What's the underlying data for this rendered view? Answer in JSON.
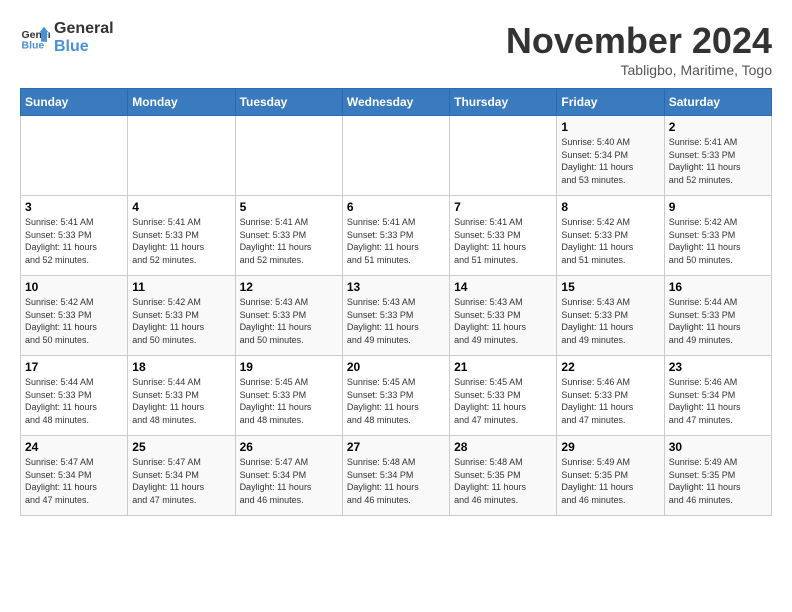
{
  "logo": {
    "line1": "General",
    "line2": "Blue"
  },
  "title": "November 2024",
  "subtitle": "Tabligbo, Maritime, Togo",
  "weekdays": [
    "Sunday",
    "Monday",
    "Tuesday",
    "Wednesday",
    "Thursday",
    "Friday",
    "Saturday"
  ],
  "weeks": [
    [
      {
        "day": "",
        "info": ""
      },
      {
        "day": "",
        "info": ""
      },
      {
        "day": "",
        "info": ""
      },
      {
        "day": "",
        "info": ""
      },
      {
        "day": "",
        "info": ""
      },
      {
        "day": "1",
        "info": "Sunrise: 5:40 AM\nSunset: 5:34 PM\nDaylight: 11 hours\nand 53 minutes."
      },
      {
        "day": "2",
        "info": "Sunrise: 5:41 AM\nSunset: 5:33 PM\nDaylight: 11 hours\nand 52 minutes."
      }
    ],
    [
      {
        "day": "3",
        "info": "Sunrise: 5:41 AM\nSunset: 5:33 PM\nDaylight: 11 hours\nand 52 minutes."
      },
      {
        "day": "4",
        "info": "Sunrise: 5:41 AM\nSunset: 5:33 PM\nDaylight: 11 hours\nand 52 minutes."
      },
      {
        "day": "5",
        "info": "Sunrise: 5:41 AM\nSunset: 5:33 PM\nDaylight: 11 hours\nand 52 minutes."
      },
      {
        "day": "6",
        "info": "Sunrise: 5:41 AM\nSunset: 5:33 PM\nDaylight: 11 hours\nand 51 minutes."
      },
      {
        "day": "7",
        "info": "Sunrise: 5:41 AM\nSunset: 5:33 PM\nDaylight: 11 hours\nand 51 minutes."
      },
      {
        "day": "8",
        "info": "Sunrise: 5:42 AM\nSunset: 5:33 PM\nDaylight: 11 hours\nand 51 minutes."
      },
      {
        "day": "9",
        "info": "Sunrise: 5:42 AM\nSunset: 5:33 PM\nDaylight: 11 hours\nand 50 minutes."
      }
    ],
    [
      {
        "day": "10",
        "info": "Sunrise: 5:42 AM\nSunset: 5:33 PM\nDaylight: 11 hours\nand 50 minutes."
      },
      {
        "day": "11",
        "info": "Sunrise: 5:42 AM\nSunset: 5:33 PM\nDaylight: 11 hours\nand 50 minutes."
      },
      {
        "day": "12",
        "info": "Sunrise: 5:43 AM\nSunset: 5:33 PM\nDaylight: 11 hours\nand 50 minutes."
      },
      {
        "day": "13",
        "info": "Sunrise: 5:43 AM\nSunset: 5:33 PM\nDaylight: 11 hours\nand 49 minutes."
      },
      {
        "day": "14",
        "info": "Sunrise: 5:43 AM\nSunset: 5:33 PM\nDaylight: 11 hours\nand 49 minutes."
      },
      {
        "day": "15",
        "info": "Sunrise: 5:43 AM\nSunset: 5:33 PM\nDaylight: 11 hours\nand 49 minutes."
      },
      {
        "day": "16",
        "info": "Sunrise: 5:44 AM\nSunset: 5:33 PM\nDaylight: 11 hours\nand 49 minutes."
      }
    ],
    [
      {
        "day": "17",
        "info": "Sunrise: 5:44 AM\nSunset: 5:33 PM\nDaylight: 11 hours\nand 48 minutes."
      },
      {
        "day": "18",
        "info": "Sunrise: 5:44 AM\nSunset: 5:33 PM\nDaylight: 11 hours\nand 48 minutes."
      },
      {
        "day": "19",
        "info": "Sunrise: 5:45 AM\nSunset: 5:33 PM\nDaylight: 11 hours\nand 48 minutes."
      },
      {
        "day": "20",
        "info": "Sunrise: 5:45 AM\nSunset: 5:33 PM\nDaylight: 11 hours\nand 48 minutes."
      },
      {
        "day": "21",
        "info": "Sunrise: 5:45 AM\nSunset: 5:33 PM\nDaylight: 11 hours\nand 47 minutes."
      },
      {
        "day": "22",
        "info": "Sunrise: 5:46 AM\nSunset: 5:33 PM\nDaylight: 11 hours\nand 47 minutes."
      },
      {
        "day": "23",
        "info": "Sunrise: 5:46 AM\nSunset: 5:34 PM\nDaylight: 11 hours\nand 47 minutes."
      }
    ],
    [
      {
        "day": "24",
        "info": "Sunrise: 5:47 AM\nSunset: 5:34 PM\nDaylight: 11 hours\nand 47 minutes."
      },
      {
        "day": "25",
        "info": "Sunrise: 5:47 AM\nSunset: 5:34 PM\nDaylight: 11 hours\nand 47 minutes."
      },
      {
        "day": "26",
        "info": "Sunrise: 5:47 AM\nSunset: 5:34 PM\nDaylight: 11 hours\nand 46 minutes."
      },
      {
        "day": "27",
        "info": "Sunrise: 5:48 AM\nSunset: 5:34 PM\nDaylight: 11 hours\nand 46 minutes."
      },
      {
        "day": "28",
        "info": "Sunrise: 5:48 AM\nSunset: 5:35 PM\nDaylight: 11 hours\nand 46 minutes."
      },
      {
        "day": "29",
        "info": "Sunrise: 5:49 AM\nSunset: 5:35 PM\nDaylight: 11 hours\nand 46 minutes."
      },
      {
        "day": "30",
        "info": "Sunrise: 5:49 AM\nSunset: 5:35 PM\nDaylight: 11 hours\nand 46 minutes."
      }
    ]
  ]
}
